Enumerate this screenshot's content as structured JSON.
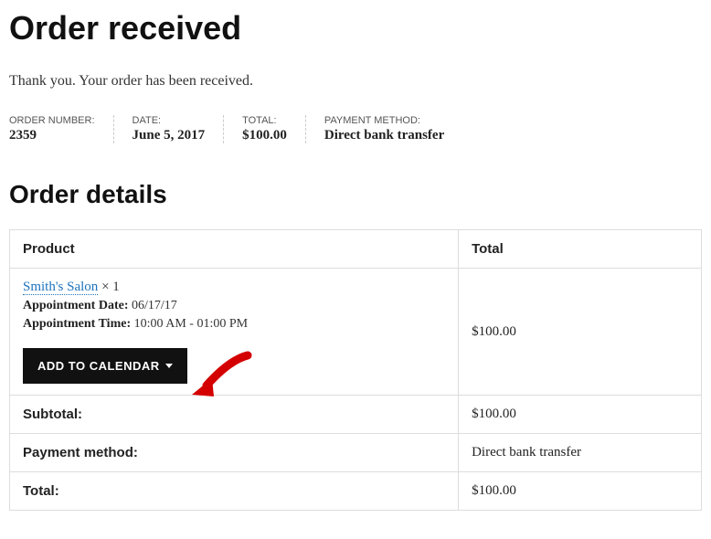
{
  "title": "Order received",
  "thank_you": "Thank you. Your order has been received.",
  "summary": {
    "order_number_label": "ORDER NUMBER:",
    "order_number": "2359",
    "date_label": "DATE:",
    "date": "June 5, 2017",
    "total_label": "TOTAL:",
    "total": "$100.00",
    "payment_label": "PAYMENT METHOD:",
    "payment": "Direct bank transfer"
  },
  "details_heading": "Order details",
  "table": {
    "col_product": "Product",
    "col_total": "Total",
    "product_name": "Smith's Salon",
    "product_qty": " × 1",
    "appt_date_label": "Appointment Date:",
    "appt_date": "06/17/17",
    "appt_time_label": "Appointment Time:",
    "appt_time": "10:00 AM - 01:00 PM",
    "line_total": "$100.00",
    "button_label": "ADD TO CALENDAR",
    "subtotal_label": "Subtotal:",
    "subtotal": "$100.00",
    "payment_method_label": "Payment method:",
    "payment_method": "Direct bank transfer",
    "total_label": "Total:",
    "total": "$100.00"
  }
}
